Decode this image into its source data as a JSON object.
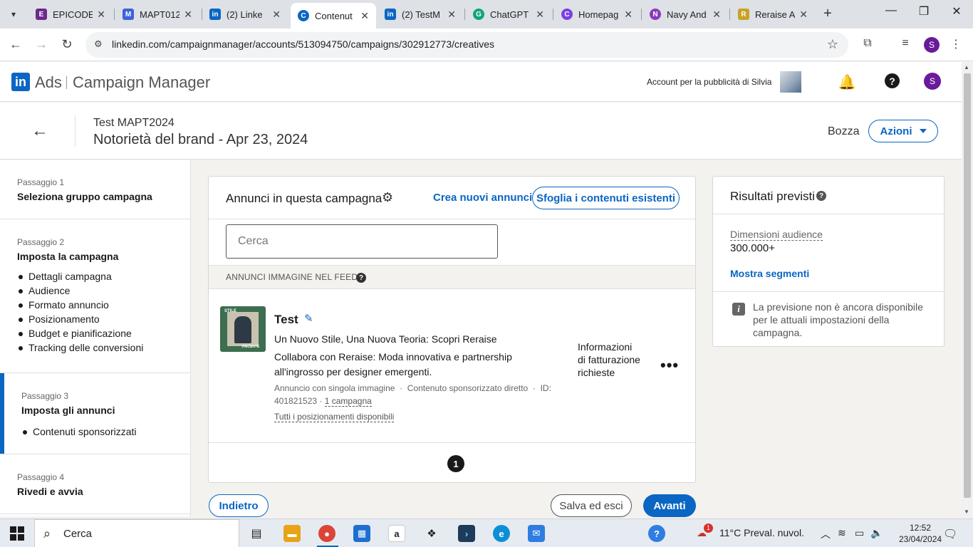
{
  "browser": {
    "tabs": [
      {
        "label": "EPICODE",
        "color": "#6c2a8c",
        "icon": "epicode-icon"
      },
      {
        "label": "MAPT012",
        "color": "#3d63d8",
        "icon": "app-icon"
      },
      {
        "label": "(2) Linke",
        "color": "#0a66c2",
        "icon": "linkedin-icon"
      },
      {
        "label": "Contenut",
        "color": "#0a66c2",
        "icon": "campaign-manager-icon"
      },
      {
        "label": "(2) TestM",
        "color": "#0a66c2",
        "icon": "linkedin-icon"
      },
      {
        "label": "ChatGPT",
        "color": "#10a37f",
        "icon": "chatgpt-icon"
      },
      {
        "label": "Homepag",
        "color": "#7b3fe4",
        "icon": "canva-icon"
      },
      {
        "label": "Navy And",
        "color": "#8a3ab9",
        "icon": "app-icon"
      },
      {
        "label": "Reraise A",
        "color": "#c9a227",
        "icon": "reraise-icon"
      }
    ],
    "url": "linkedin.com/campaignmanager/accounts/513094750/campaigns/302912773/creatives",
    "profile_initial": "S"
  },
  "header": {
    "brand_ads": "Ads",
    "brand_product": "Campaign Manager",
    "account_label": "Account per la pubblicità di Silvia",
    "profile_initial": "S"
  },
  "campaign": {
    "group": "Test MAPT2024",
    "name": "Notorietà del brand - Apr 23, 2024",
    "status": "Bozza",
    "actions_label": "Azioni"
  },
  "steps": [
    {
      "number": "Passaggio 1",
      "title": "Seleziona gruppo campagna",
      "items": []
    },
    {
      "number": "Passaggio 2",
      "title": "Imposta la campagna",
      "items": [
        "Dettagli campagna",
        "Audience",
        "Formato annuncio",
        "Posizionamento",
        "Budget e pianificazione",
        "Tracking delle conversioni"
      ]
    },
    {
      "number": "Passaggio 3",
      "title": "Imposta gli annunci",
      "items": [
        "Contenuti sponsorizzati"
      ]
    },
    {
      "number": "Passaggio 4",
      "title": "Rivedi e avvia",
      "items": []
    }
  ],
  "ads_panel": {
    "title": "Annunci in questa campagna",
    "create_label": "Crea nuovi annunci",
    "browse_label": "Sfoglia i contenuti esistenti",
    "search_placeholder": "Cerca",
    "section_label": "ANNUNCI IMMAGINE NEL FEED",
    "ad": {
      "thumb_top": "STILE",
      "thumb_bottom": "VINCENTE",
      "name": "Test",
      "headline": "Un Nuovo Stile, Una Nuova Teoria: Scopri Reraise",
      "description": "Collabora con Reraise: Moda innovativa e partnership all'ingrosso per designer emergenti.",
      "meta_type": "Annuncio con singola immagine",
      "meta_content": "Contenuto sponsorizzato diretto",
      "meta_id": "ID: 401821523",
      "meta_campaigns": "1 campagna",
      "placements": "Tutti i posizionamenti disponibili",
      "billing_status": "Informazioni di fatturazione richieste"
    },
    "current_page": "1"
  },
  "footer_buttons": {
    "back": "Indietro",
    "save": "Salva ed esci",
    "next": "Avanti"
  },
  "forecast": {
    "title": "Risultati previsti",
    "audience_label": "Dimensioni audience",
    "audience_value": "300.000+",
    "segments_label": "Mostra segmenti",
    "info_text": "La previsione non è ancora disponibile per le attuali impostazioni della campagna."
  },
  "taskbar": {
    "search_placeholder": "Cerca",
    "weather": "11°C  Preval. nuvol.",
    "weather_badge": "1",
    "time": "12:52",
    "date": "23/04/2024"
  }
}
